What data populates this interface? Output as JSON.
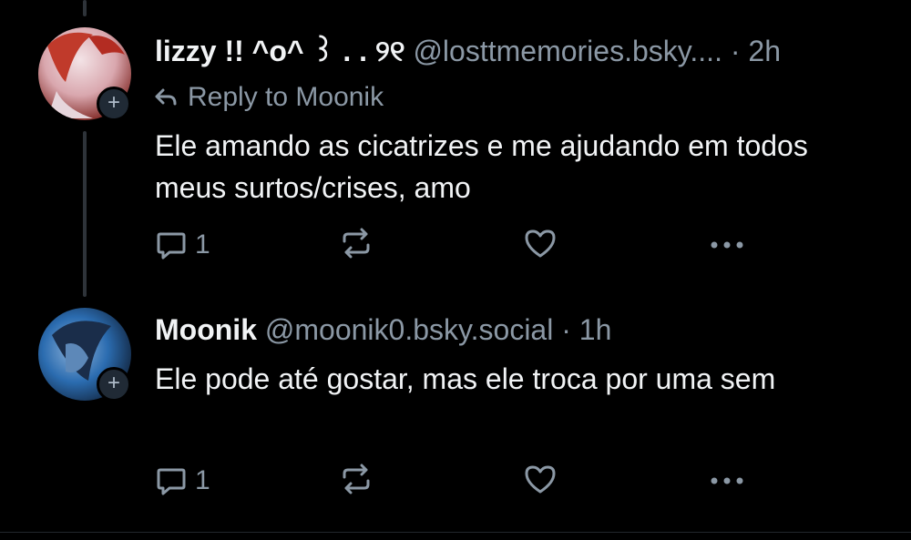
{
  "posts": [
    {
      "display_name": "lizzy !! ^o^ ꒱ . . ୨୧",
      "handle": "@losttmemories.bsky....",
      "separator": "·",
      "time": "2h",
      "reply_to": "Reply to Moonik",
      "text": "Ele amando as cicatrizes e me ajudando em todos meus surtos/crises, amo",
      "reply_count": "1",
      "avatar_colors": [
        "#c03a2b",
        "#e9d2d8"
      ]
    },
    {
      "display_name": "Moonik",
      "handle": "@moonik0.bsky.social",
      "separator": "·",
      "time": "1h",
      "text": "Ele pode até gostar, mas ele troca por uma sem",
      "reply_count": "1",
      "avatar_colors": [
        "#2b6cb0",
        "#1a2d4a"
      ]
    }
  ],
  "icons": {
    "reply": "reply-bubble-icon",
    "repost": "repost-icon",
    "like": "heart-icon",
    "more": "more-dots-icon",
    "follow": "plus-icon",
    "reply_arrow": "reply-arrow-icon"
  },
  "colors": {
    "background": "#000000",
    "muted": "#8b98a5",
    "text": "#f1f3f5"
  }
}
